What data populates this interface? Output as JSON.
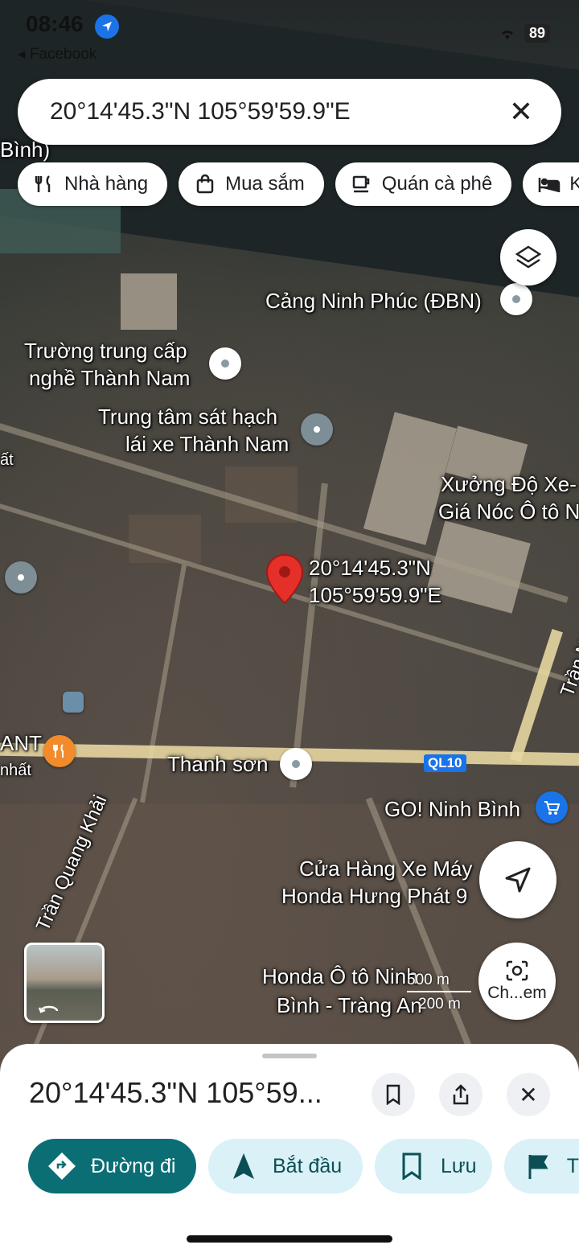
{
  "status": {
    "time": "08:46",
    "back_app": "◂ Facebook",
    "battery": "89"
  },
  "search": {
    "query": "20°14'45.3\"N 105°59'59.9\"E",
    "close_icon": "close-icon"
  },
  "chips": [
    {
      "label": "Nhà hàng",
      "icon": "restaurant-icon"
    },
    {
      "label": "Mua sắm",
      "icon": "shopping-bag-icon"
    },
    {
      "label": "Quán cà phê",
      "icon": "coffee-icon"
    },
    {
      "label": "K",
      "icon": "hotel-icon"
    }
  ],
  "map": {
    "labels": {
      "cang": "Cảng Ninh Phúc (ĐBN)",
      "truong_1": "Trường trung cấp",
      "truong_2": "nghề Thành Nam",
      "ttsh_1": "Trung tâm sát hạch",
      "ttsh_2": "lái xe Thành Nam",
      "xuong_1": "Xưởng Độ Xe-",
      "xuong_2": "Giá Nóc Ô tô N",
      "pin_coords_1": "20°14'45.3\"N",
      "pin_coords_2": "105°59'59.9\"E",
      "thanh_son": "Thanh sơn",
      "ql10": "QL10",
      "go": "GO! Ninh Bình",
      "cuahang_1": "Cửa Hàng Xe Máy",
      "cuahang_2": "Honda Hưng Phát 9",
      "honda_1": "Honda Ô tô Ninh",
      "honda_2": "Bình - Tràng An",
      "tran_quang_khai": "Trần Quang Khải",
      "tran_right": "Trần N",
      "ant": "ANT",
      "nhat": "nhất",
      "binh_top": "Bình)",
      "at_left": "ất",
      "scale_1": "500 m",
      "scale_2": "200 m"
    },
    "layers_icon": "layers-icon",
    "locate_icon": "navigation-arrow-icon",
    "lens_label": "Ch...em"
  },
  "sheet": {
    "title": "20°14'45.3\"N 105°59...",
    "actions": [
      {
        "label": "Đường đi",
        "icon": "directions-icon",
        "primary": true
      },
      {
        "label": "Bắt đầu",
        "icon": "navigation-icon",
        "primary": false
      },
      {
        "label": "Lưu",
        "icon": "bookmark-icon",
        "primary": false
      },
      {
        "label": "T",
        "icon": "flag-icon",
        "primary": false
      }
    ]
  },
  "colors": {
    "primary": "#0b6e75",
    "secondary_bg": "#d9f1f7",
    "pin_red": "#e5302a"
  }
}
